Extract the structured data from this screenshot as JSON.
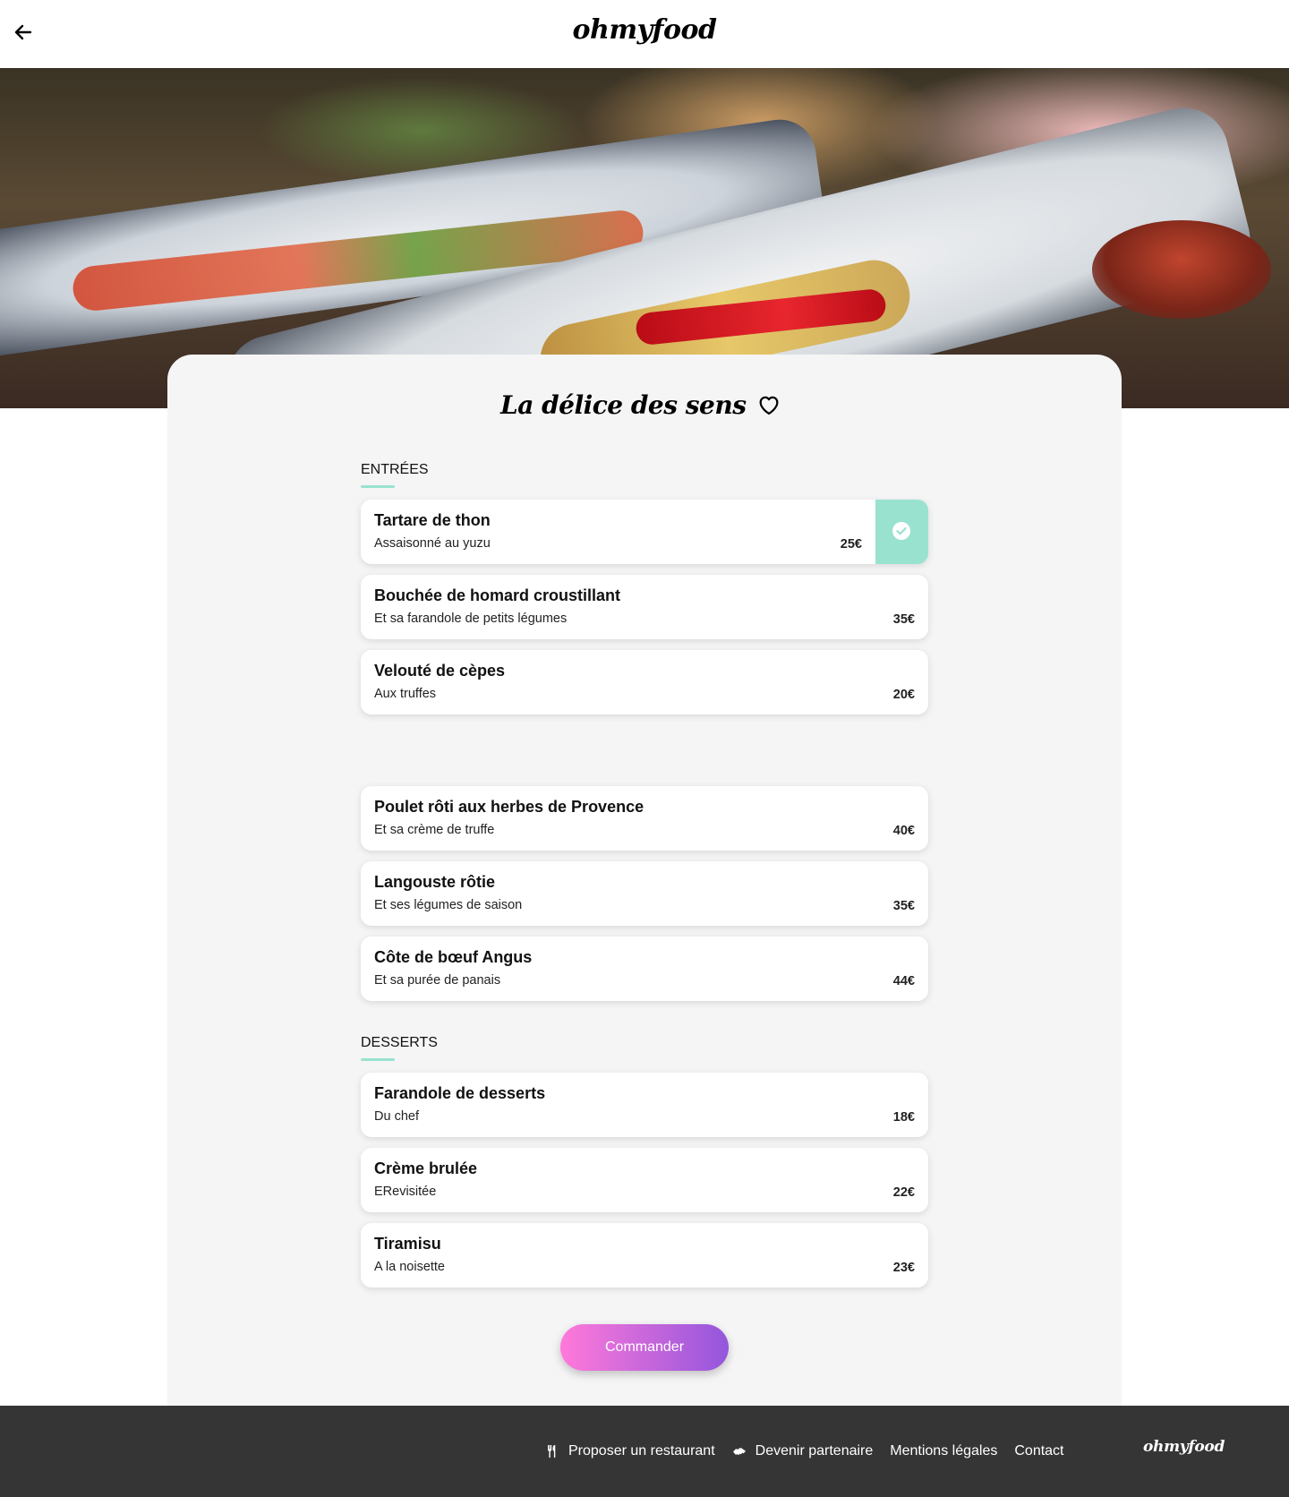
{
  "header": {
    "logo": "ohmyfood"
  },
  "restaurant": {
    "title": "La délice des sens"
  },
  "sections": [
    {
      "label": "ENTRÉES",
      "items": [
        {
          "name": "Tartare de thon",
          "desc": "Assaisonné au yuzu",
          "price": "25€",
          "selected": true
        },
        {
          "name": "Bouchée de homard croustillant",
          "desc": "Et sa farandole de petits légumes",
          "price": "35€",
          "selected": false
        },
        {
          "name": "Velouté de cèpes",
          "desc": "Aux truffes",
          "price": "20€",
          "selected": false
        }
      ]
    },
    {
      "label": "",
      "items": [
        {
          "name": "Poulet rôti aux herbes de Provence",
          "desc": "Et sa crème de truffe",
          "price": "40€",
          "selected": false
        },
        {
          "name": "Langouste rôtie",
          "desc": "Et ses légumes de saison",
          "price": "35€",
          "selected": false
        },
        {
          "name": "Côte de bœuf Angus",
          "desc": "Et sa purée de panais",
          "price": "44€",
          "selected": false
        }
      ]
    },
    {
      "label": "DESSERTS",
      "items": [
        {
          "name": "Farandole de desserts",
          "desc": "Du chef",
          "price": "18€",
          "selected": false
        },
        {
          "name": "Crème brulée",
          "desc": "ERevisitée",
          "price": "22€",
          "selected": false
        },
        {
          "name": "Tiramisu",
          "desc": "A la noisette",
          "price": "23€",
          "selected": false
        }
      ]
    }
  ],
  "order_button": "Commander",
  "footer": {
    "links": [
      {
        "label": "Proposer un restaurant",
        "icon": "utensils-icon"
      },
      {
        "label": "Devenir partenaire",
        "icon": "handshake-icon"
      },
      {
        "label": "Mentions légales",
        "icon": ""
      },
      {
        "label": "Contact",
        "icon": ""
      }
    ],
    "logo": "ohmyfood"
  },
  "colors": {
    "accent": "#99e2d0",
    "button_start": "#ff79da",
    "button_end": "#9356dc",
    "footer_bg": "#353535",
    "card_bg": "#f5f5f5"
  }
}
